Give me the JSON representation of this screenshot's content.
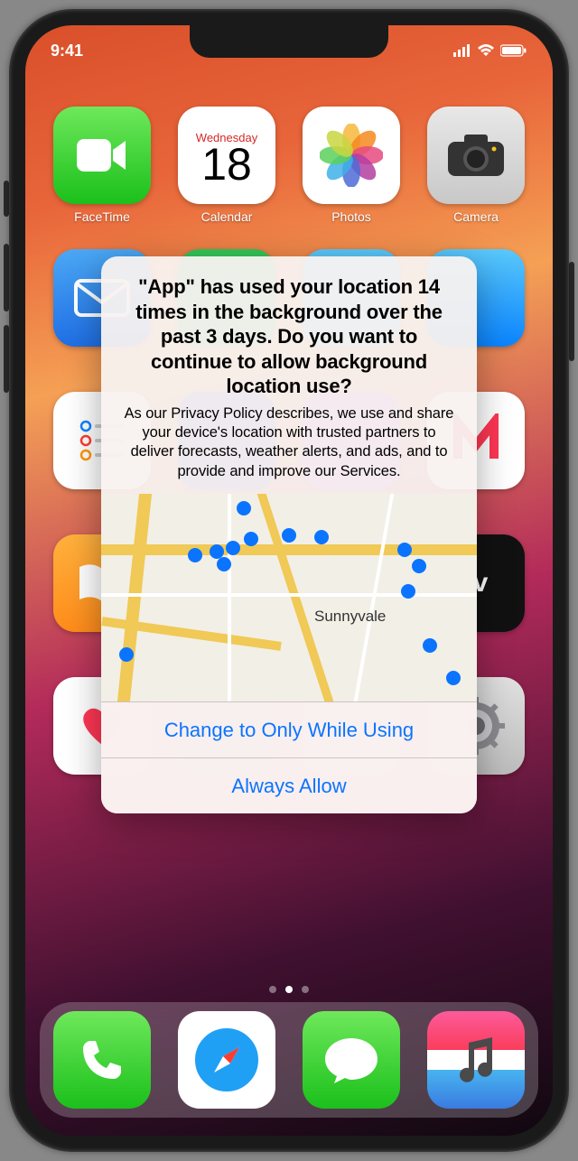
{
  "status": {
    "time": "9:41"
  },
  "apps": {
    "row1": [
      {
        "label": "FaceTime"
      },
      {
        "label": "Calendar",
        "weekday": "Wednesday",
        "date": "18"
      },
      {
        "label": "Photos"
      },
      {
        "label": "Camera"
      }
    ]
  },
  "alert": {
    "title": "\"App\" has used your location 14 times in the background over the past 3 days. Do you want to continue to allow background location use?",
    "description": "As our Privacy Policy describes, we use and share your device's location with trusted partners to deliver forecasts, weather alerts, and ads, and to provide and improve our Services.",
    "map_label": "Sunnyvale",
    "button1": "Change to Only While Using",
    "button2": "Always Allow"
  }
}
